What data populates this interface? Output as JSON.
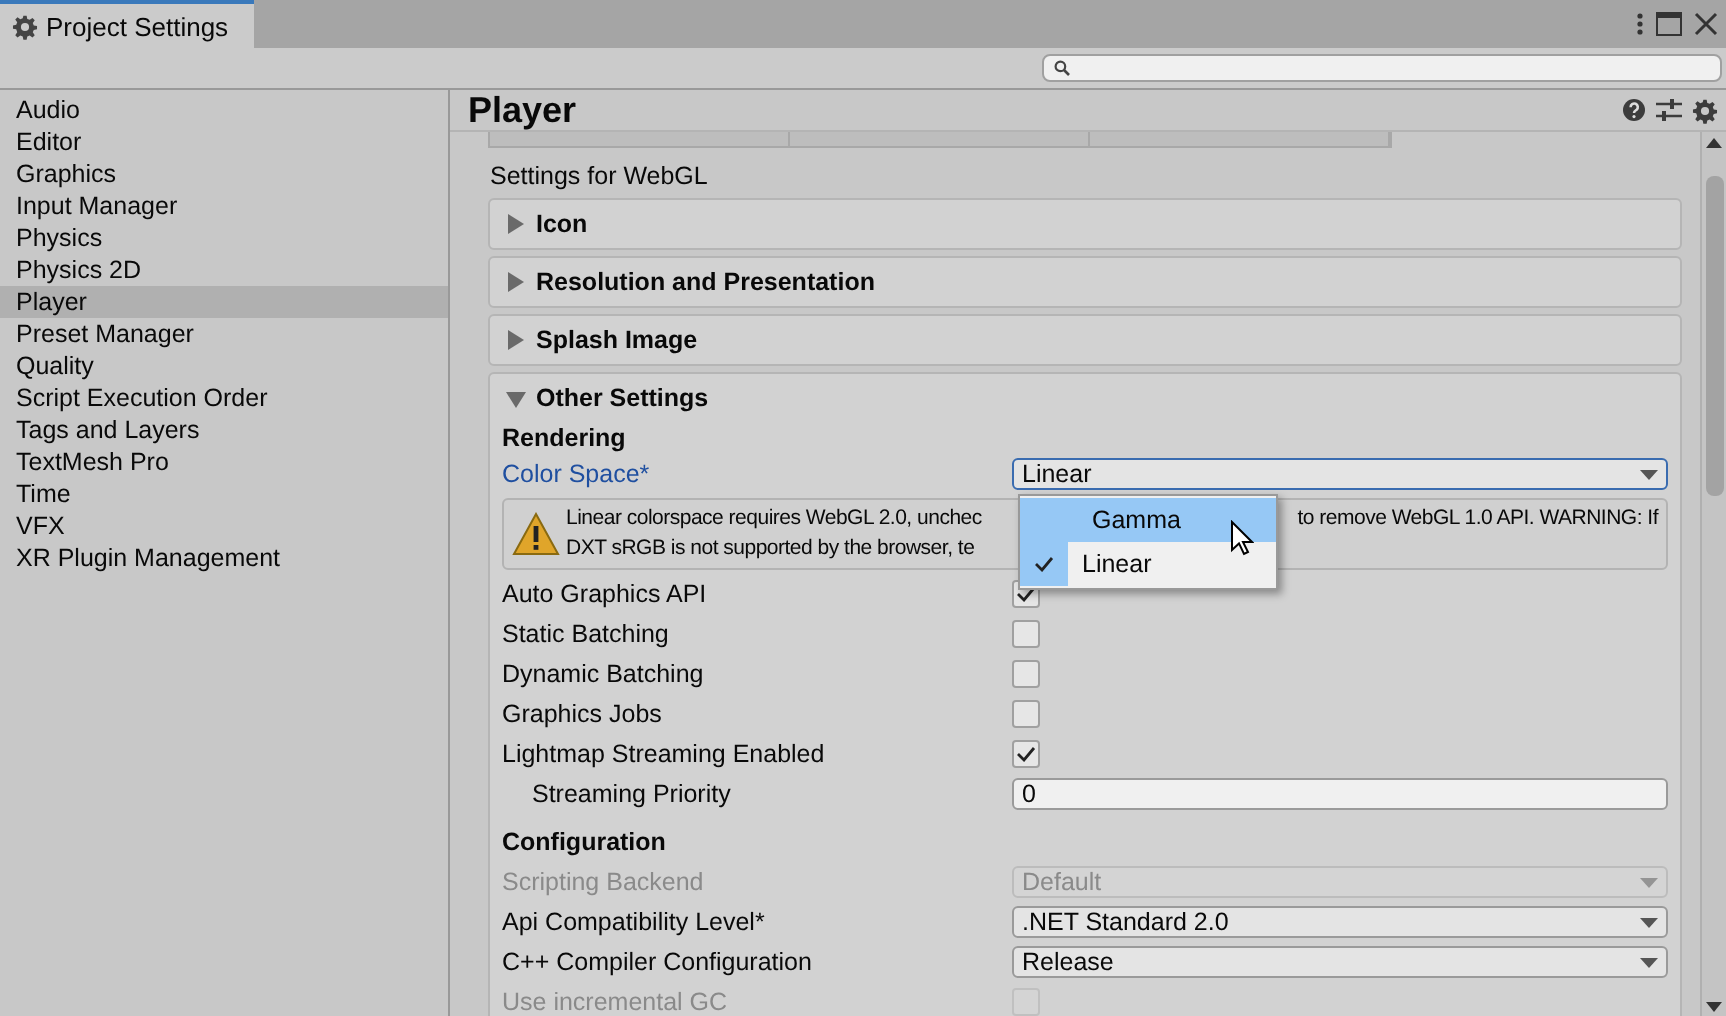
{
  "window": {
    "title": "Project Settings"
  },
  "sidebar": {
    "items": [
      {
        "label": "Audio",
        "selected": false
      },
      {
        "label": "Editor",
        "selected": false
      },
      {
        "label": "Graphics",
        "selected": false
      },
      {
        "label": "Input Manager",
        "selected": false
      },
      {
        "label": "Physics",
        "selected": false
      },
      {
        "label": "Physics 2D",
        "selected": false
      },
      {
        "label": "Player",
        "selected": true
      },
      {
        "label": "Preset Manager",
        "selected": false
      },
      {
        "label": "Quality",
        "selected": false
      },
      {
        "label": "Script Execution Order",
        "selected": false
      },
      {
        "label": "Tags and Layers",
        "selected": false
      },
      {
        "label": "TextMesh Pro",
        "selected": false
      },
      {
        "label": "Time",
        "selected": false
      },
      {
        "label": "VFX",
        "selected": false
      },
      {
        "label": "XR Plugin Management",
        "selected": false
      }
    ]
  },
  "header": {
    "title": "Player"
  },
  "platform_label": "Settings for WebGL",
  "sections": [
    {
      "title": "Icon",
      "expanded": false
    },
    {
      "title": "Resolution and Presentation",
      "expanded": false
    },
    {
      "title": "Splash Image",
      "expanded": false
    },
    {
      "title": "Other Settings",
      "expanded": true
    }
  ],
  "groups": [
    {
      "heading": "Rendering",
      "rows": [
        {
          "kind": "dropdown",
          "label": "Color Space*",
          "value": "Linear",
          "focused": true,
          "disabled": false
        },
        {
          "kind": "warning",
          "parts": [
            "Linear colorspace requires WebGL 2.0, unchec",
            "to remove WebGL 1.0 API. WARNING: If",
            "DXT sRGB is not supported by the browser, te"
          ]
        },
        {
          "kind": "checkbox",
          "label": "Auto Graphics API",
          "checked": true,
          "disabled": false
        },
        {
          "kind": "checkbox",
          "label": "Static Batching",
          "checked": false,
          "disabled": false
        },
        {
          "kind": "checkbox",
          "label": "Dynamic Batching",
          "checked": false,
          "disabled": false
        },
        {
          "kind": "checkbox",
          "label": "Graphics Jobs",
          "checked": false,
          "disabled": false
        },
        {
          "kind": "checkbox",
          "label": "Lightmap Streaming Enabled",
          "checked": true,
          "disabled": false
        },
        {
          "kind": "field",
          "label": "Streaming Priority",
          "value": "0",
          "indented": true,
          "disabled": false
        }
      ]
    },
    {
      "heading": "Configuration",
      "rows": [
        {
          "kind": "dropdown",
          "label": "Scripting Backend",
          "value": "Default",
          "focused": false,
          "disabled": true
        },
        {
          "kind": "dropdown",
          "label": "Api Compatibility Level*",
          "value": ".NET Standard 2.0",
          "focused": false,
          "disabled": false
        },
        {
          "kind": "dropdown",
          "label": "C++ Compiler Configuration",
          "value": "Release",
          "focused": false,
          "disabled": false
        },
        {
          "kind": "checkbox",
          "label": "Use incremental GC",
          "checked": false,
          "disabled": true
        }
      ]
    }
  ],
  "popup": {
    "options": [
      {
        "label": "Gamma",
        "selected": false,
        "highlighted": true
      },
      {
        "label": "Linear",
        "selected": true,
        "highlighted": false
      }
    ]
  }
}
